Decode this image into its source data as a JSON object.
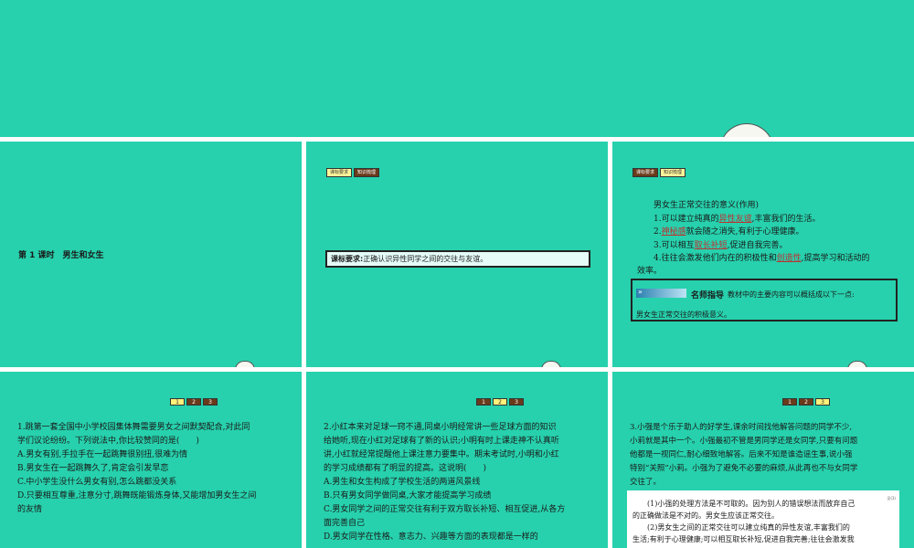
{
  "slide1": {},
  "slide2": {
    "title": "第 1 课时　男生和女生"
  },
  "slide3": {
    "tabs": [
      "课标要求",
      "知识梳理"
    ],
    "label": "课标要求:",
    "text": "正确认识异性同学之间的交往与友谊。"
  },
  "slide4": {
    "tabs": [
      "课标要求",
      "知识梳理"
    ],
    "heading": "男女生正常交往的意义(作用)",
    "item1_pre": "1.可以建立纯真的",
    "item1_ul": "异性友谊",
    "item1_post": ",丰富我们的生活。",
    "item2_pre": "2.",
    "item2_ul": "神秘感",
    "item2_post": "就会随之消失,有利于心理健康。",
    "item3_pre": "3.可以相互",
    "item3_ul": "取长补短",
    "item3_post": ",促进自我完善。",
    "item4_pre": "4.往往会激发他们内在的积极性和",
    "item4_ul": "创造性",
    "item4_post": ",提高学习和活动的",
    "item4_cont": "效率。",
    "tip_title": "名师指导",
    "tip_text": "教材中的主要内容可以概括成以下一点:",
    "tip_text2": "男女生正常交往的积极意义。"
  },
  "slide5": {
    "nums": [
      "1",
      "2",
      "3"
    ],
    "q": "1.跳第一套全国中小学校园集体舞需要男女之间默契配合,对此同",
    "q2": "学们议论纷纷。下列说法中,你比较赞同的是(　　)",
    "a": "A.男女有别,手拉手在一起跳舞很别扭,很难为情",
    "b": "B.男女生在一起跳舞久了,肯定会引发早恋",
    "c": "C.中小学生没什么男女有别,怎么跳都没关系",
    "d": "D.只要相互尊重,注意分寸,跳舞既能锻炼身体,又能增加男女生之间",
    "d2": "的友情"
  },
  "slide6": {
    "nums": [
      "1",
      "2",
      "3"
    ],
    "lines": [
      "2.小红本来对足球一窍不通,同桌小明经常讲一些足球方面的知识",
      "给她听,现在小红对足球有了新的认识;小明有时上课走神不认真听",
      "讲,小红就经常提醒他上课注意力要集中。期末考试时,小明和小红",
      "的学习成绩都有了明显的提高。这说明(　　)",
      "A.男生和女生构成了学校生活的两道风景线",
      "B.只有男女同学做同桌,大家才能提高学习成绩",
      "C.男女同学之间的正常交往有利于双方取长补短、相互促进,从各方",
      "面完善自己",
      "D.男女同学在性格、意志力、兴趣等方面的表现都是一样的"
    ]
  },
  "slide7": {
    "nums": [
      "1",
      "2",
      "3"
    ],
    "lines": [
      "3.小强是个乐于助人的好学生,课余时间找他解答问题的同学不少,",
      "小莉就是其中一个。小强最初不管是男同学还是女同学,只要有问题",
      "他都是一视同仁,耐心细致地解答。后来不知是谁造谣生事,说小强",
      "特别“关照”小莉。小强为了避免不必要的麻烦,从此再也不与女同学",
      "交往了。"
    ],
    "ans_tag": "见(3)",
    "answers": [
      "　　(1)小强的处理方法是不可取的。因为别人的错误想法而放弃自己",
      "的正确做法是不对的。男女生应该正常交往。",
      "　　(2)男女生之间的正常交往可以建立纯真的异性友谊,丰富我们的",
      "生活;有利于心理健康;可以相互取长补短,促进自我完善;往往会激发我"
    ]
  }
}
